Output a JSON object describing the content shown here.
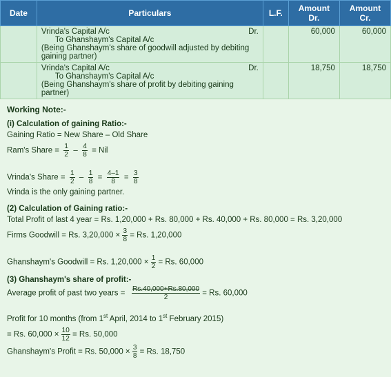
{
  "table": {
    "headers": [
      "Date",
      "Particulars",
      "L.F.",
      "Amount Dr.",
      "Amount Cr."
    ],
    "rows": [
      {
        "date": "",
        "particulars_main": "Vrinda's Capital A/c",
        "dr_label": "Dr.",
        "sub_entry": "To Ghanshaym's Capital A/c",
        "note": "(Being Ghanshaym's share of goodwill adjusted by debiting gaining partner)",
        "amount_dr": "60,000",
        "amount_cr": "60,000"
      },
      {
        "date": "",
        "particulars_main": "Vrinda's Capital A/c",
        "dr_label": "Dr.",
        "sub_entry": "To Ghanshaym's Capital A/c",
        "note": "(Being Ghanshaym's share of profit by debiting gaining partner)",
        "amount_dr": "18,750",
        "amount_cr": "18,750"
      }
    ]
  },
  "working_notes": {
    "title": "Working Note:-",
    "section1": {
      "heading": "(i) Calculation of gaining Ratio:-",
      "line1": "Gaining Ratio = New Share – Old Share",
      "ram_label": "Ram's Share =",
      "ram_frac1_num": "1",
      "ram_frac1_den": "2",
      "ram_minus": "–",
      "ram_frac2_num": "4",
      "ram_frac2_den": "8",
      "ram_result": "= Nil",
      "vrinda_label": "Vrinda's Share =",
      "v_frac1_num": "1",
      "v_frac1_den": "2",
      "v_minus": "–",
      "v_frac2_num": "1",
      "v_frac2_den": "8",
      "v_eq1": "=",
      "v_frac3_num": "4–1",
      "v_frac3_den": "8",
      "v_eq2": "=",
      "v_frac4_num": "3",
      "v_frac4_den": "8",
      "conclusion": "Vrinda is the only gaining partner."
    },
    "section2": {
      "heading": "(2) Calculation of Gaining ratio:-",
      "line1": "Total Profit of last 4 year = Rs. 1,20,000 + Rs. 80,000 + Rs. 40,000 + Rs. 80,000 = Rs. 3,20,000",
      "line2": "Firms Goodwill = Rs. 3,20,000 ×",
      "fw_frac_num": "3",
      "fw_frac_den": "8",
      "fw_result": "= Rs. 1,20,000",
      "line3": "Ghanshaym's Goodwill = Rs. 1,20,000 ×",
      "gg_frac_num": "1",
      "gg_frac_den": "2",
      "gg_result": "= Rs. 60,000"
    },
    "section3": {
      "heading": "(3) Ghanshaym's share of profit:-",
      "line1_prefix": "Average profit of past two years =",
      "avg_num": "Rs.40,000+Rs.80,000",
      "avg_den": "2",
      "avg_result": "= Rs. 60,000",
      "line2": "Profit for 10 months (from 1",
      "line2_sup": "st",
      "line2_cont": " April, 2014 to 1",
      "line2_sup2": "st",
      "line2_cont2": " February 2015)",
      "line3_prefix": "= Rs. 60,000 ×",
      "p_frac_num": "10",
      "p_frac_den": "12",
      "p_result": "= Rs. 50,000",
      "line4": "Ghanshaym's Profit = Rs. 50,000 ×",
      "gp_frac_num": "3",
      "gp_frac_den": "8",
      "gp_result": "= Rs. 18,750"
    }
  }
}
